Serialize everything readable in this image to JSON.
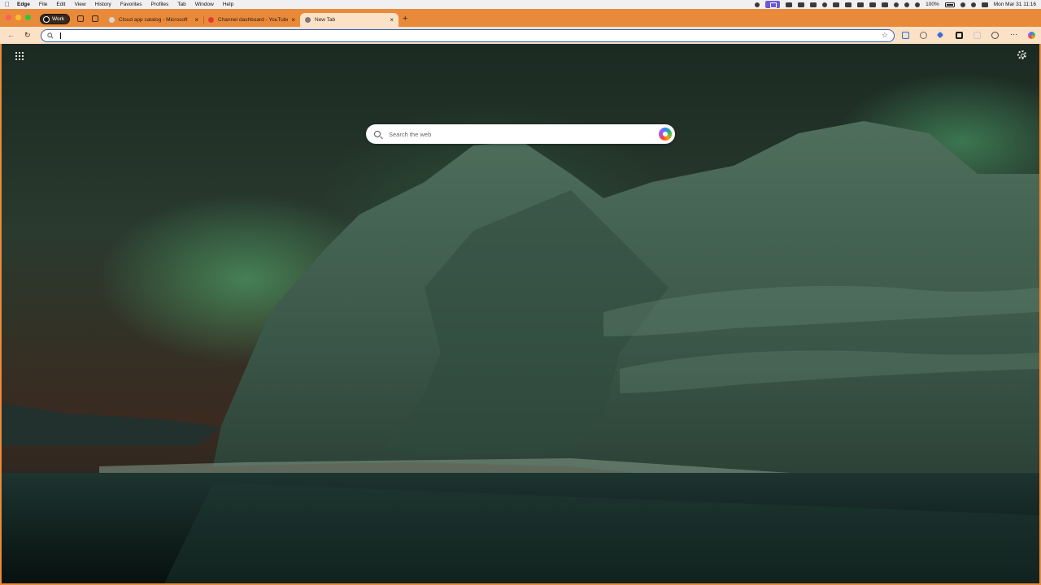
{
  "menubar": {
    "app_name": "Edge",
    "items": [
      "File",
      "Edit",
      "View",
      "History",
      "Favorites",
      "Profiles",
      "Tab",
      "Window",
      "Help"
    ],
    "battery": "100%",
    "datetime": "Mon Mar 31  11:16"
  },
  "browser": {
    "profile_label": "Work",
    "tabs": [
      {
        "title": "Cloud app catalog - Microsoft",
        "favicon_color": "#d6d6d6",
        "active": false
      },
      {
        "title": "Channel dashboard - YouTube",
        "favicon_color": "#e53935",
        "active": false
      },
      {
        "title": "New Tab",
        "favicon_color": "#7a7a7a",
        "active": true
      }
    ],
    "address_value": "",
    "accent": "#e98a3b"
  },
  "newtab": {
    "search_placeholder": "Search the web"
  }
}
